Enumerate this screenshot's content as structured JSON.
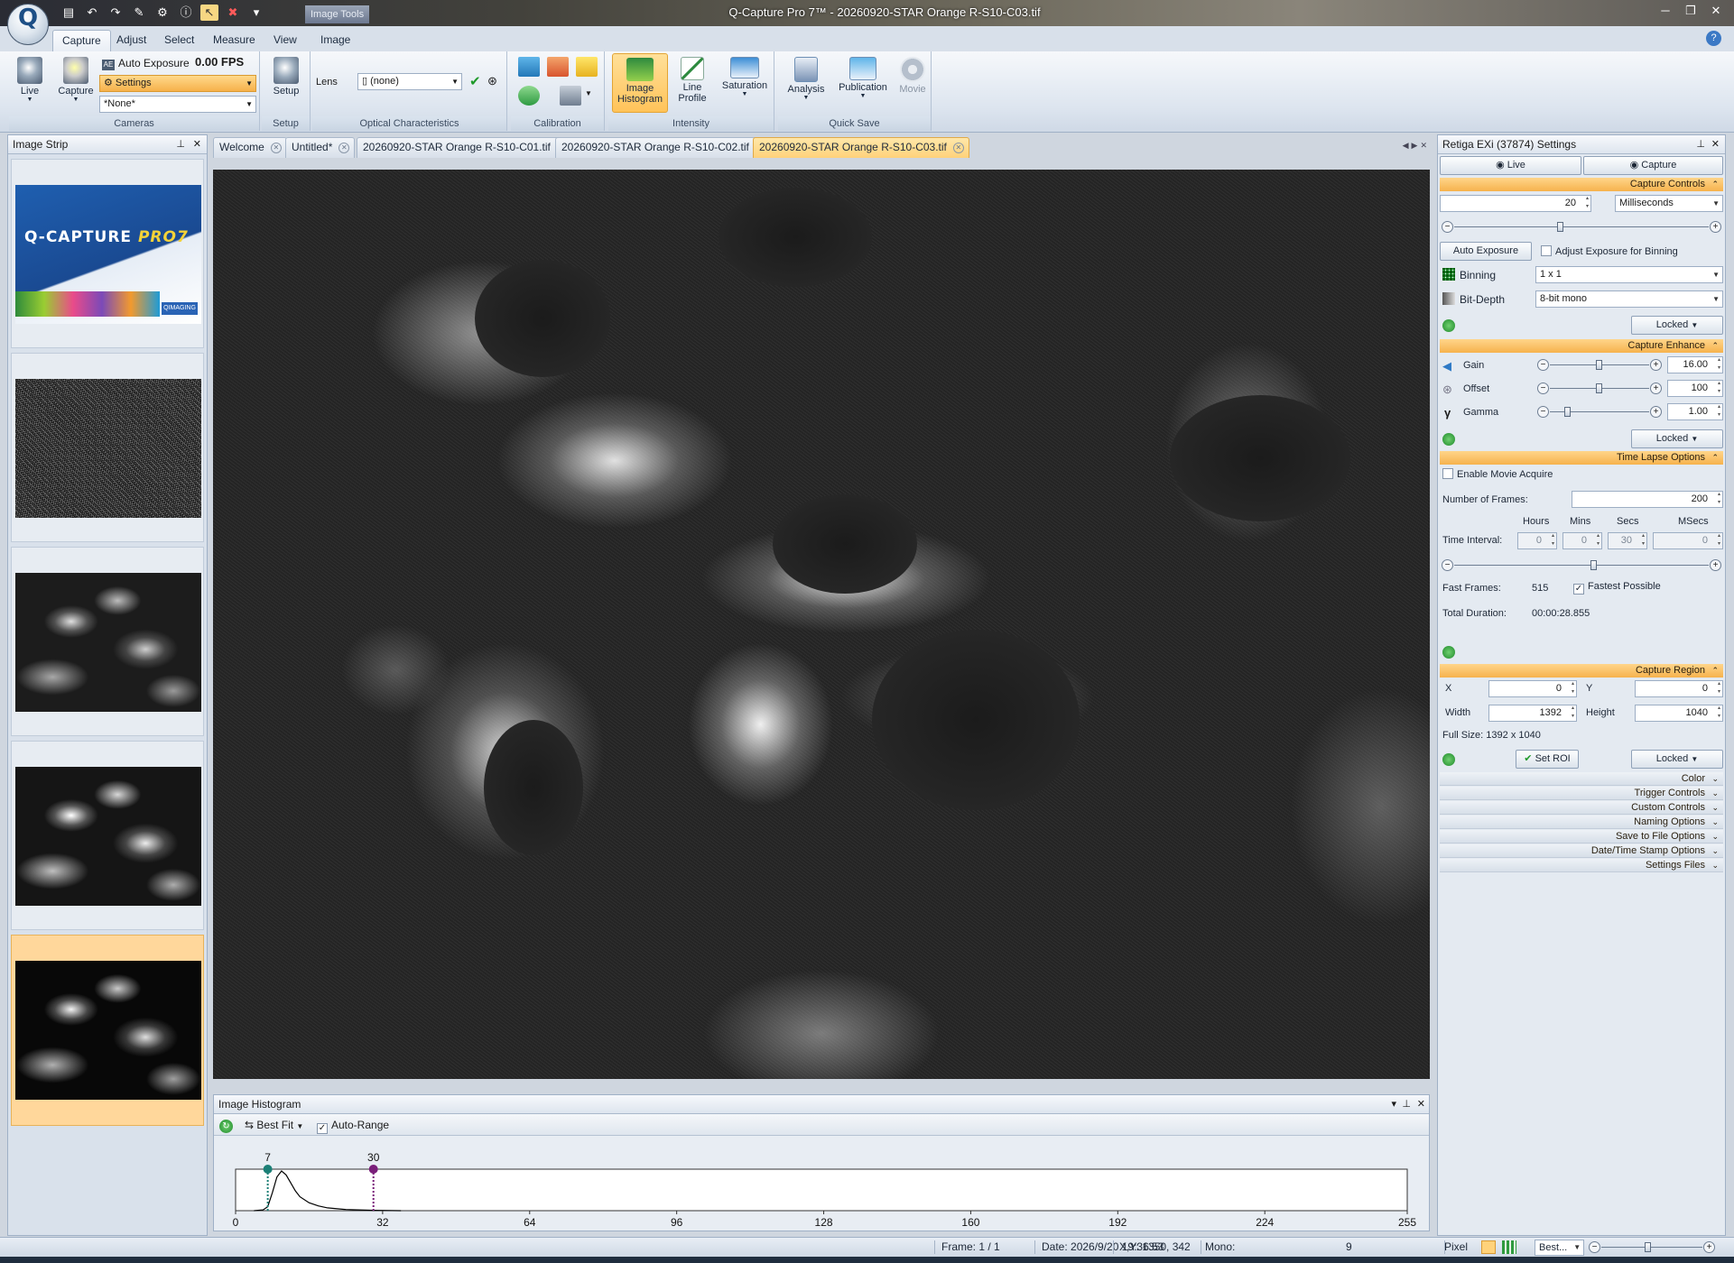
{
  "window": {
    "title": "Q-Capture Pro 7™ - 20260920-STAR Orange R-S10-C03.tif",
    "context_tab": "Image Tools",
    "controls": [
      "─",
      "❐",
      "✕"
    ]
  },
  "app_orb_letter": "Q",
  "ribbon": {
    "tabs": [
      "Capture",
      "Adjust",
      "Select",
      "Measure",
      "View",
      "Image"
    ],
    "active_tab": "Capture",
    "cameras": {
      "live_label": "Live",
      "capture_label": "Capture",
      "auto_exposure_label": "Auto Exposure",
      "fps": "0.00 FPS",
      "settings_label": "Settings",
      "preset_value": "*None*",
      "group_label": "Cameras"
    },
    "setup": {
      "button_label": "Setup",
      "group_label": "Setup"
    },
    "optical": {
      "lens_label": "Lens",
      "lens_value": "(none)",
      "group_label": "Optical Characteristics"
    },
    "calibration": {
      "group_label": "Calibration"
    },
    "intensity": {
      "histogram_label_1": "Image",
      "histogram_label_2": "Histogram",
      "line_profile_label_1": "Line",
      "line_profile_label_2": "Profile",
      "saturation_label": "Saturation",
      "group_label": "Intensity"
    },
    "quick_save": {
      "analysis_label": "Analysis",
      "publication_label": "Publication",
      "movie_label": "Movie",
      "group_label": "Quick Save"
    }
  },
  "image_strip": {
    "title": "Image Strip",
    "splash_logo": "Q-CAPTURE",
    "splash_logo_accent": "PRO7",
    "splash_badge": "QIMAGING"
  },
  "doc_tabs": [
    "Welcome",
    "Untitled*",
    "20260920-STAR Orange R-S10-C01.tif",
    "20260920-STAR Orange R-S10-C02.tif",
    "20260920-STAR Orange R-S10-C03.tif"
  ],
  "histogram": {
    "title": "Image Histogram",
    "fit_label": "Best Fit",
    "auto_range_label": "Auto-Range",
    "marker_low": 7,
    "marker_high": 30,
    "low_color": "#1b7f76",
    "high_color": "#7a1f7a",
    "axis_ticks": [
      0,
      32,
      64,
      96,
      128,
      160,
      192,
      224,
      255
    ],
    "axis_max": 255,
    "curve": [
      [
        4,
        0
      ],
      [
        6,
        0.02
      ],
      [
        7,
        0.1
      ],
      [
        8,
        0.45
      ],
      [
        9,
        0.85
      ],
      [
        10,
        1.0
      ],
      [
        11,
        0.9
      ],
      [
        12,
        0.7
      ],
      [
        13,
        0.5
      ],
      [
        14,
        0.35
      ],
      [
        16,
        0.2
      ],
      [
        18,
        0.12
      ],
      [
        20,
        0.07
      ],
      [
        24,
        0.03
      ],
      [
        30,
        0.01
      ],
      [
        36,
        0.0
      ]
    ]
  },
  "settings": {
    "title": "Retiga EXi (37874) Settings",
    "live_tab": "Live",
    "capture_tab": "Capture",
    "capture_controls": {
      "head": "Capture Controls",
      "exposure_value": "20",
      "exposure_unit": "Milliseconds",
      "exposure_slider": 0.42,
      "auto_exposure_btn": "Auto Exposure",
      "adjust_binning_label": "Adjust Exposure for Binning",
      "binning_label": "Binning",
      "binning_value": "1 x 1",
      "bit_depth_label": "Bit-Depth",
      "bit_depth_value": "8-bit mono",
      "locked": "Locked"
    },
    "capture_enhance": {
      "head": "Capture Enhance",
      "gain_label": "Gain",
      "gain_value": "16.00",
      "gain_slider": 0.5,
      "offset_label": "Offset",
      "offset_value": "100",
      "offset_slider": 0.5,
      "gamma_label": "Gamma",
      "gamma_value": "1.00",
      "gamma_slider": 0.18,
      "locked": "Locked"
    },
    "time_lapse": {
      "head": "Time Lapse Options",
      "enable_movie_label": "Enable Movie Acquire",
      "frames_label": "Number of Frames:",
      "frames_value": "200",
      "hours_label": "Hours",
      "mins_label": "Mins",
      "secs_label": "Secs",
      "msecs_label": "MSecs",
      "interval_label": "Time Interval:",
      "hours": "0",
      "mins": "0",
      "secs": "30",
      "msecs": "0",
      "interval_slider": 0.55,
      "fast_frames_label": "Fast Frames:",
      "fast_frames_value": "515",
      "fastest_label": "Fastest Possible",
      "total_label": "Total Duration:",
      "total_value": "00:00:28.855"
    },
    "capture_region": {
      "head": "Capture Region",
      "x_label": "X",
      "x_value": "0",
      "y_label": "Y",
      "y_value": "0",
      "width_label": "Width",
      "width_value": "1392",
      "height_label": "Height",
      "height_value": "1040",
      "full_size": "Full Size: 1392 x 1040",
      "set_roi_btn": "Set ROI",
      "locked": "Locked"
    },
    "collapsed_sections": [
      "Color",
      "Trigger Controls",
      "Custom Controls",
      "Naming Options",
      "Save to File Options",
      "Date/Time Stamp Options",
      "Settings Files"
    ]
  },
  "status": {
    "frame": "Frame: 1 / 1",
    "date": "Date: 2026/9/20 19:36:53",
    "xy": "X,Y: 1350,  342",
    "mono_label": "Mono:",
    "mono_value": "9",
    "pixel_label": "Pixel",
    "zoom_label": "Best..."
  }
}
